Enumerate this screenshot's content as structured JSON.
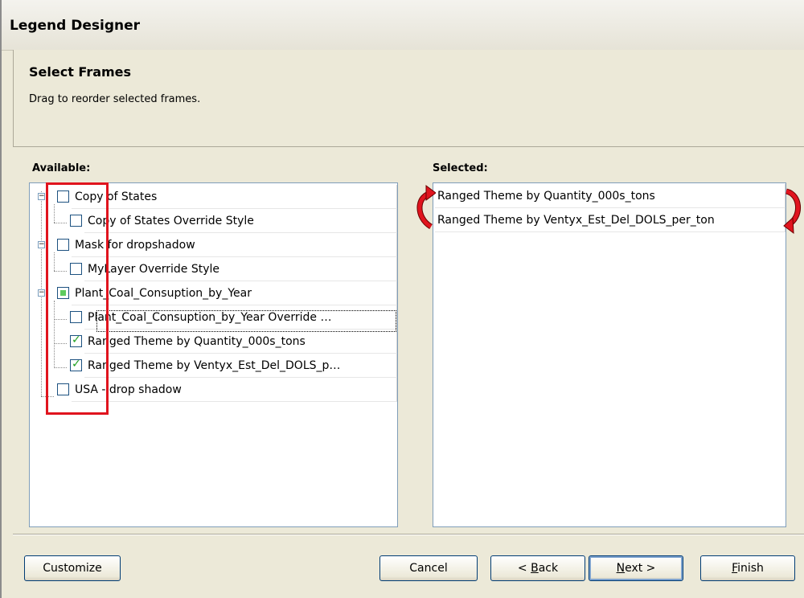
{
  "window": {
    "title": "Legend Designer"
  },
  "header": {
    "title": "Select Frames",
    "subtitle": "Drag to reorder selected frames."
  },
  "available": {
    "label": "Available:",
    "items": [
      {
        "label": "Copy of States",
        "state": "unchecked",
        "expandable": true
      },
      {
        "label": "Copy of States Override Style",
        "state": "unchecked",
        "expandable": false
      },
      {
        "label": "Mask for dropshadow",
        "state": "unchecked",
        "expandable": true
      },
      {
        "label": "MyLayer Override Style",
        "state": "unchecked",
        "expandable": false
      },
      {
        "label": "Plant_Coal_Consuption_by_Year",
        "state": "partial",
        "expandable": true
      },
      {
        "label": "Plant_Coal_Consuption_by_Year Override …",
        "state": "unchecked",
        "expandable": false
      },
      {
        "label": "Ranged Theme by Quantity_000s_tons",
        "state": "checked",
        "expandable": false
      },
      {
        "label": "Ranged Theme by Ventyx_Est_Del_DOLS_p…",
        "state": "checked",
        "expandable": false
      },
      {
        "label": "USA - drop shadow",
        "state": "unchecked",
        "expandable": false
      }
    ]
  },
  "selected": {
    "label": "Selected:",
    "items": [
      {
        "label": "Ranged Theme by Quantity_000s_tons"
      },
      {
        "label": "Ranged Theme by Ventyx_Est_Del_DOLS_per_ton"
      }
    ]
  },
  "buttons": {
    "customize": "Customize",
    "cancel": "Cancel",
    "back_prefix": "< ",
    "back_hot": "B",
    "back_rest": "ack",
    "next_hot": "N",
    "next_rest": "ext >",
    "finish_hot": "F",
    "finish_rest": "inish"
  },
  "colors": {
    "annotation_red": "#e0141e",
    "check_green": "#21a121",
    "dialog_bg": "#ece9d8"
  },
  "icons": {
    "expander": "minus-box-icon",
    "reorder": "curved-arrow-icon"
  }
}
